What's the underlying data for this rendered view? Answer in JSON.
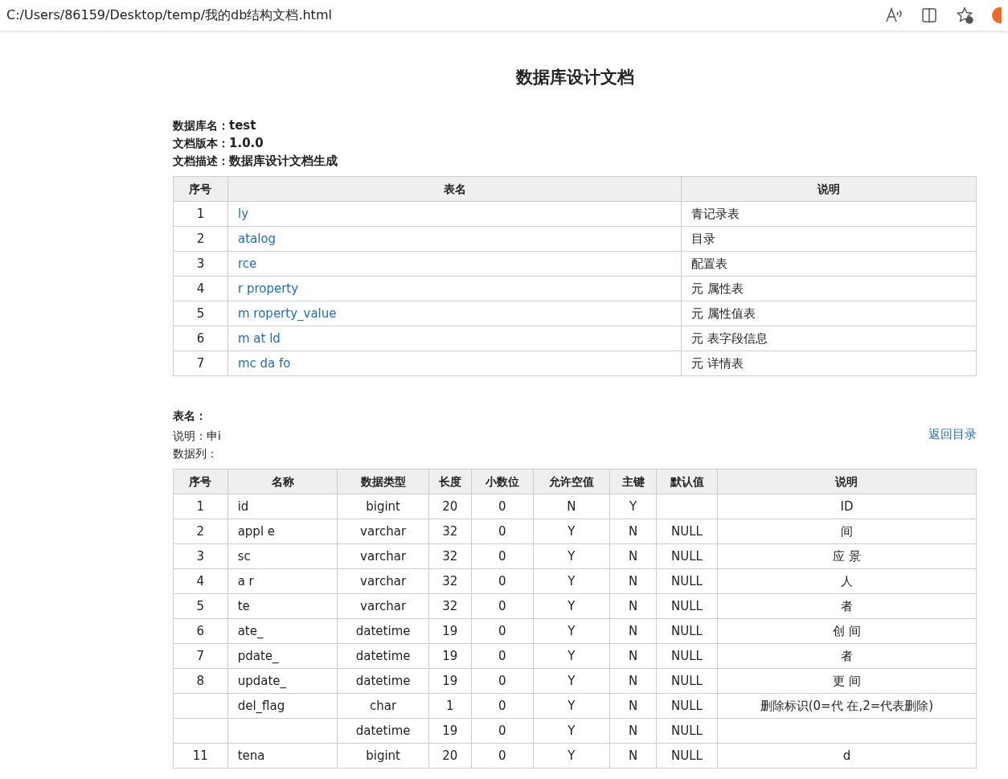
{
  "address_bar": {
    "url": "C:/Users/86159/Desktop/temp/我的db结构文档.html"
  },
  "title": "数据库设计文档",
  "info": [
    {
      "label": "数据库名：",
      "value": "test"
    },
    {
      "label": "文档版本：",
      "value": "1.0.0"
    },
    {
      "label": "文档描述：",
      "value": "数据库设计文档生成"
    }
  ],
  "index_table": {
    "columns": [
      "序号",
      "表名",
      "说明"
    ],
    "rows": [
      {
        "no": "1",
        "name": "ly",
        "desc": "青记录表"
      },
      {
        "no": "2",
        "name": "atalog",
        "desc": "目录"
      },
      {
        "no": "3",
        "name": "rce",
        "desc": "配置表"
      },
      {
        "no": "4",
        "name": "r  property",
        "desc": "元  属性表"
      },
      {
        "no": "5",
        "name": "m  roperty_value",
        "desc": "元  属性值表"
      },
      {
        "no": "6",
        "name": "m  at  ld",
        "desc": "元  表字段信息"
      },
      {
        "no": "7",
        "name": "mc  da  fo",
        "desc": "元  详情表"
      }
    ]
  },
  "detail": {
    "table_label": "表名：",
    "desc_label": "说明：",
    "desc_value": "申i",
    "columns_label": "数据列：",
    "back_link": "返回目录",
    "columns": [
      "序号",
      "名称",
      "数据类型",
      "长度",
      "小数位",
      "允许空值",
      "主键",
      "默认值",
      "说明"
    ],
    "rows": [
      [
        "1",
        "id",
        "bigint",
        "20",
        "0",
        "N",
        "Y",
        "",
        "ID"
      ],
      [
        "2",
        "appl  e",
        "varchar",
        "32",
        "0",
        "Y",
        "N",
        "NULL",
        "间"
      ],
      [
        "3",
        "sc",
        "varchar",
        "32",
        "0",
        "Y",
        "N",
        "NULL",
        "应  景"
      ],
      [
        "4",
        "a  r",
        "varchar",
        "32",
        "0",
        "Y",
        "N",
        "NULL",
        "人"
      ],
      [
        "5",
        "te",
        "varchar",
        "32",
        "0",
        "Y",
        "N",
        "NULL",
        "者"
      ],
      [
        "6",
        "ate_",
        "datetime",
        "19",
        "0",
        "Y",
        "N",
        "NULL",
        "创  间"
      ],
      [
        "7",
        "pdate_",
        "datetime",
        "19",
        "0",
        "Y",
        "N",
        "NULL",
        "者"
      ],
      [
        "8",
        "update_",
        "datetime",
        "19",
        "0",
        "Y",
        "N",
        "NULL",
        "更  间"
      ],
      [
        "",
        "del_flag",
        "char",
        "1",
        "0",
        "Y",
        "N",
        "NULL",
        "删除标识(0=代  在,2=代表删除)"
      ],
      [
        "",
        "",
        "datetime",
        "19",
        "0",
        "Y",
        "N",
        "NULL",
        ""
      ],
      [
        "11",
        "tena",
        "bigint",
        "20",
        "0",
        "Y",
        "N",
        "NULL",
        "d"
      ]
    ]
  }
}
